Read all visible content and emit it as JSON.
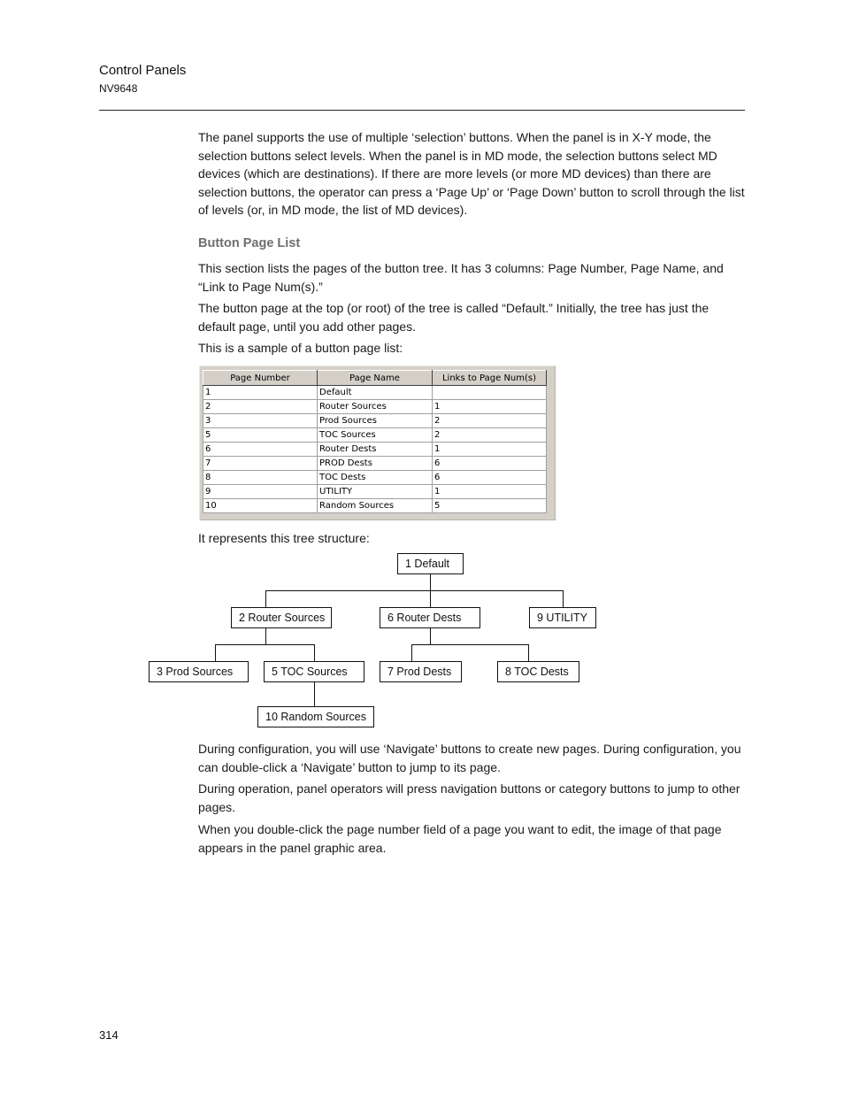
{
  "header": {
    "title": "Control Panels",
    "subtitle": "NV9648"
  },
  "paragraphs": {
    "intro": "The panel supports the use of multiple ‘selection’ buttons. When the panel is in X-Y mode, the selection buttons select levels. When the panel is in MD mode, the selection buttons select MD devices (which are destinations). If there are more levels (or more MD devices) than there are selection buttons, the operator can press a ‘Page Up’ or ‘Page Down’ button to scroll through the list of levels (or, in MD mode, the list of MD devices).",
    "section_heading": "Button Page List",
    "section_p1": "This section lists the pages of the button tree. It has 3 columns: Page Number, Page Name, and “Link to Page Num(s).”",
    "section_p2": "The button page at the top (or root) of the tree is called “Default.” Initially, the tree has just the default page, until you add other pages.",
    "section_p3": "This is a sample of a button page list:",
    "tree_intro": "It represents this tree structure:",
    "config_p": "During configuration, you will use ‘Navigate’ buttons to create new pages. During configuration, you can double-click a ‘Navigate’ button to jump to its page.",
    "operation_p": "During operation, panel operators will press navigation buttons or category buttons to jump to other pages.",
    "edit_p": "When you double-click the page number field of a page you want to edit, the image of that page appears in the panel graphic area."
  },
  "page_list_table": {
    "columns": [
      "Page Number",
      "Page Name",
      "Links to Page Num(s)"
    ],
    "rows": [
      [
        "1",
        "Default",
        ""
      ],
      [
        "2",
        "Router Sources",
        "1"
      ],
      [
        "3",
        "Prod Sources",
        "2"
      ],
      [
        "5",
        "TOC Sources",
        "2"
      ],
      [
        "6",
        "Router Dests",
        "1"
      ],
      [
        "7",
        "PROD Dests",
        "6"
      ],
      [
        "8",
        "TOC Dests",
        "6"
      ],
      [
        "9",
        "UTILITY",
        "1"
      ],
      [
        "10",
        "Random Sources",
        "5"
      ]
    ]
  },
  "tree": {
    "nodes": {
      "n1": "1 Default",
      "n2": "2 Router Sources",
      "n6": "6 Router Dests",
      "n9": "9 UTILITY",
      "n3": "3 Prod Sources",
      "n5": "5 TOC Sources",
      "n7": "7 Prod Dests",
      "n8": "8 TOC Dests",
      "n10": "10 Random Sources"
    }
  },
  "footer": {
    "page_number": "314"
  }
}
